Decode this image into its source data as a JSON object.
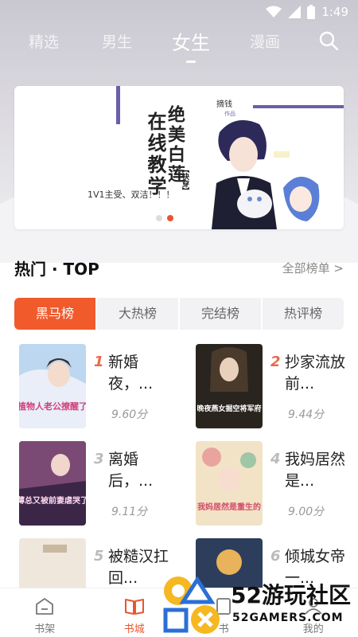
{
  "status_bar": {
    "time": "1:49"
  },
  "nav": {
    "tabs": [
      {
        "label": "精选"
      },
      {
        "label": "男生"
      },
      {
        "label": "女生"
      },
      {
        "label": "漫画"
      }
    ],
    "active_tab": "女生"
  },
  "banner": {
    "title_line1": "在线教学",
    "title_line2": "绝美白莲",
    "tag": "【快穿】",
    "subtitle": "1V1主受、双洁！！！",
    "brand": "摘钱",
    "brand_small": "作品",
    "page_count": 2,
    "active_page": 2
  },
  "section": {
    "title": "热门 · TOP",
    "more_label": "全部榜单 >"
  },
  "rank_tabs": [
    {
      "label": "黑马榜",
      "active": true
    },
    {
      "label": "大热榜",
      "active": false
    },
    {
      "label": "完结榜",
      "active": false
    },
    {
      "label": "热评榜",
      "active": false
    }
  ],
  "books": [
    {
      "rank": "1",
      "title": "新婚夜，...",
      "score": "9.60分",
      "cover_text": "植物人老公撩醒了"
    },
    {
      "rank": "2",
      "title": "抄家流放前...",
      "score": "9.44分",
      "cover_text": "晚夜燕女掘空将军府"
    },
    {
      "rank": "3",
      "title": "离婚后，...",
      "score": "9.11分",
      "cover_text": "薄总又被前妻虐哭了"
    },
    {
      "rank": "4",
      "title": "我妈居然是...",
      "score": "9.00分",
      "cover_text": "我妈居然是重生的"
    },
    {
      "rank": "5",
      "title": "被糙汉扛回...",
      "score": "",
      "cover_text": ""
    },
    {
      "rank": "6",
      "title": "倾城女帝一...",
      "score": "",
      "cover_text": ""
    }
  ],
  "bottom_nav": [
    {
      "label": "书架",
      "icon": "bookshelf-icon"
    },
    {
      "label": "书城",
      "icon": "book-open-icon"
    },
    {
      "label": "书",
      "icon": "book-icon"
    },
    {
      "label": "我的",
      "icon": "profile-icon"
    }
  ],
  "watermark": {
    "cn": "52游玩社区",
    "en": "52GAMERS.COM"
  },
  "colors": {
    "accent": "#f15a2b",
    "rank_red": "#e96a4b"
  }
}
